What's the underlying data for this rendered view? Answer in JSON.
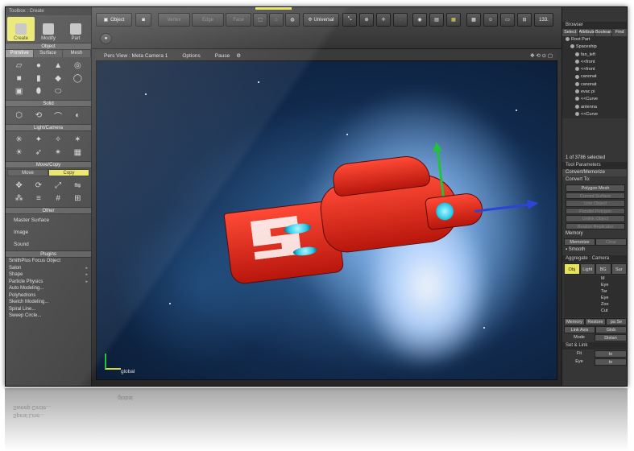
{
  "left_panel": {
    "title": "Toolbox : Create",
    "modes": [
      {
        "label": "Create",
        "active": true
      },
      {
        "label": "Modify",
        "active": false
      },
      {
        "label": "Part",
        "active": false
      }
    ],
    "object_section": "Object",
    "object_tabs": [
      {
        "label": "Primitive",
        "active": true
      },
      {
        "label": "Surface",
        "active": false
      },
      {
        "label": "Mesh",
        "active": false
      }
    ],
    "solid_section": "Solid",
    "light_camera_section": "Light/Camera",
    "move_copy_section": "Move/Copy",
    "move_copy_buttons": [
      {
        "label": "Move",
        "active": false
      },
      {
        "label": "Copy",
        "active": true
      }
    ],
    "other_section": "Other",
    "other_items": [
      "Master Surface",
      "Image",
      "Sound"
    ],
    "plugins_section": "Plugins",
    "plugin_items": [
      {
        "label": "SmithPlus Focus Object",
        "has_submenu": false
      },
      {
        "label": "Salon",
        "has_submenu": true
      },
      {
        "label": "Shape",
        "has_submenu": true
      },
      {
        "label": "Particle Physics",
        "has_submenu": true
      },
      {
        "label": "Auto Modeling...",
        "has_submenu": false
      },
      {
        "label": "Polyhedrons",
        "has_submenu": false
      },
      {
        "label": "Sketch Modeling...",
        "has_submenu": false
      },
      {
        "label": "Spiral Line...",
        "has_submenu": false
      },
      {
        "label": "Sweep Circle...",
        "has_submenu": false
      }
    ]
  },
  "toolbar": {
    "object_label": "Object",
    "vertex_label": "Vertex",
    "edge_label": "Edge",
    "face_label": "Face",
    "universal_label": "Universal",
    "zoom_value": "133."
  },
  "viewport": {
    "camera_label": "Pers View : Meta Camera 1",
    "options_label": "Options",
    "pause_label": "Pause",
    "coordinate_label": "global"
  },
  "browser": {
    "title": "Browser",
    "tabs": [
      "Select",
      "Attribute",
      "Boolean",
      "Find"
    ],
    "tree": [
      {
        "label": "Root Part"
      },
      {
        "label": "Spaceship"
      },
      {
        "label": "fan_left"
      },
      {
        "label": "<<front"
      },
      {
        "label": "<<front"
      },
      {
        "label": "canonat"
      },
      {
        "label": "canonat"
      },
      {
        "label": "evac pi"
      },
      {
        "label": "<<Curve"
      },
      {
        "label": "antenna"
      },
      {
        "label": "<<Curve"
      }
    ],
    "selection_status": "1 of 3786 selected"
  },
  "tool_parameters": {
    "title": "Tool Parameters",
    "subtitle": "Convert/Memorize",
    "convert_to": "Convert To:",
    "buttons": [
      {
        "label": "Polygon Mesh",
        "enabled": true
      },
      {
        "label": "Curved Surface",
        "enabled": false
      },
      {
        "label": "Line Object",
        "enabled": false
      },
      {
        "label": "Parallel Polygon",
        "enabled": false
      },
      {
        "label": "Unlink Object",
        "enabled": false
      },
      {
        "label": "Realize Replicator",
        "enabled": false
      }
    ],
    "memory_label": "Memory",
    "memorize_label": "Memorize",
    "clear_label": "Clear",
    "smooth_label": "Smooth"
  },
  "aggregate": {
    "title": "Aggregate : Camera",
    "tabs": [
      "Obj",
      "Light",
      "BG",
      "Sur"
    ],
    "tree": [
      "M",
      "Eye",
      "Tar",
      "Eye",
      "Zoo",
      "Cut"
    ],
    "memory_label": "Memory",
    "restore_label": "Restore",
    "space_label": "pa Se",
    "link_axis_label": "Link Axis",
    "glob_label": "Glob",
    "mode_label": "Mode",
    "distance_label": "Distan",
    "set_link_label": "Set & Link",
    "fit_label": "Fit",
    "fit_value": "to",
    "eye_label": "Eye",
    "eye_value": "to"
  },
  "colors": {
    "accent": "#e8e45a",
    "hull": "#e02a1c",
    "engine": "#2bc9e8"
  }
}
